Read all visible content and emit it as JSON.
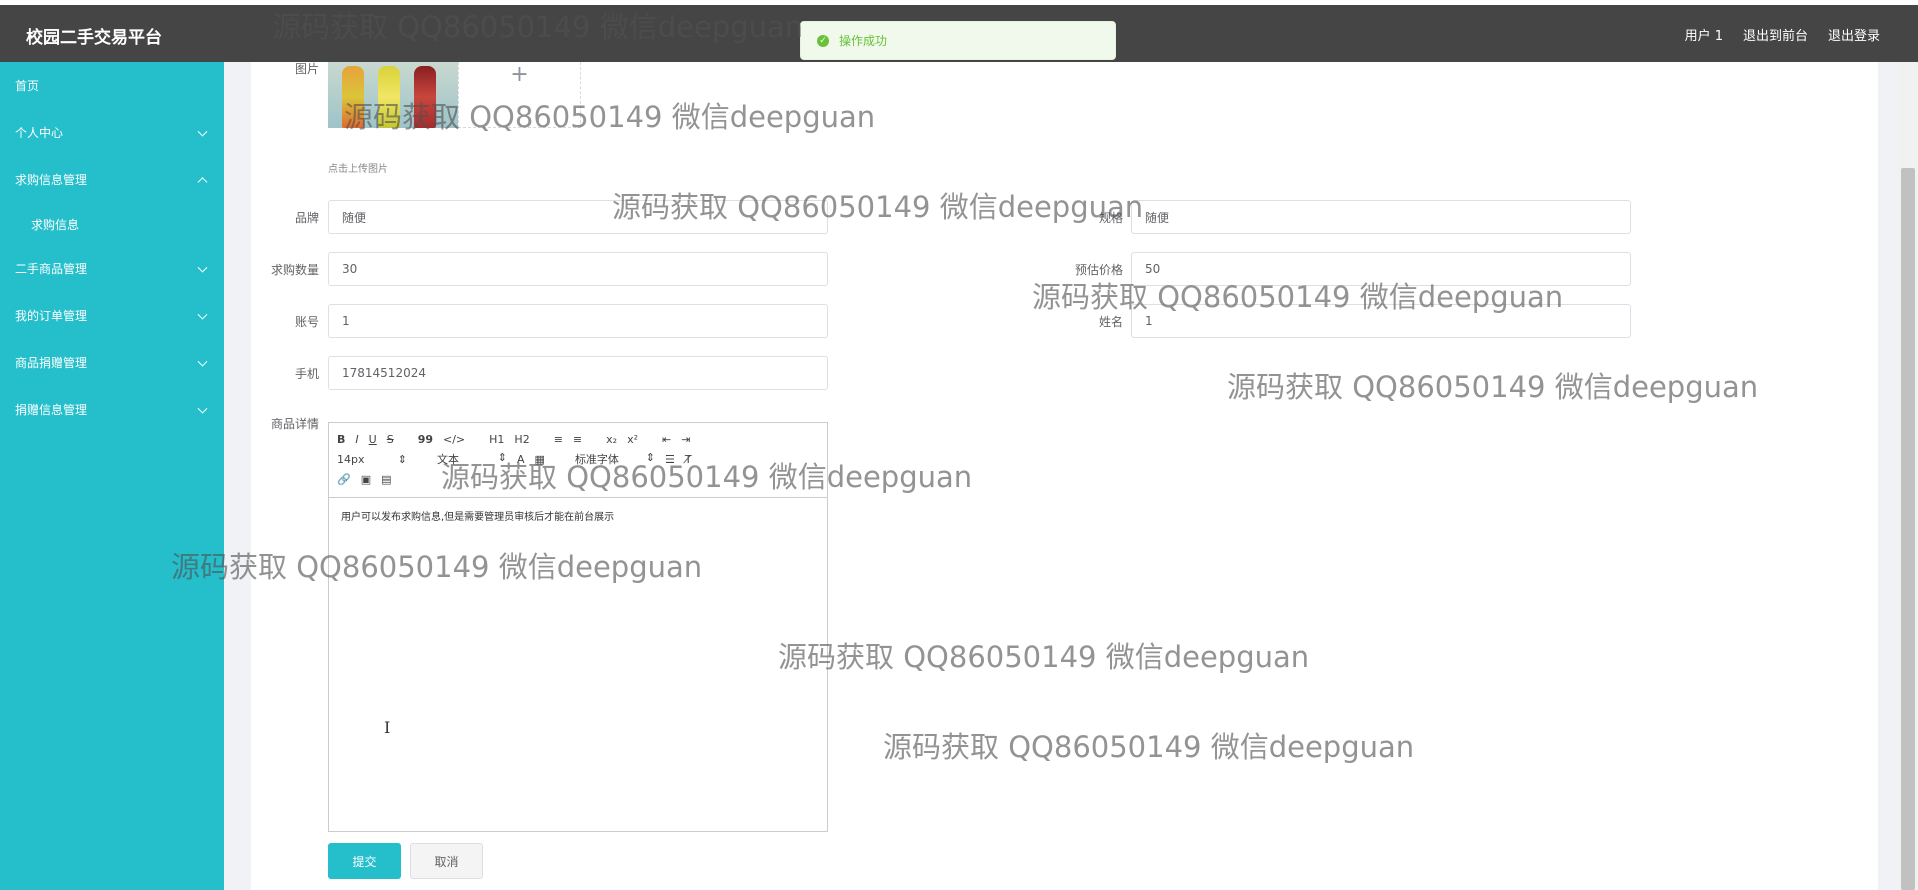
{
  "header": {
    "brand": "校园二手交易平台",
    "user": "用户 1",
    "to_front": "退出到前台",
    "logout": "退出登录"
  },
  "toast": {
    "message": "操作成功"
  },
  "sidebar": {
    "items": [
      {
        "label": "首页"
      },
      {
        "label": "个人中心"
      },
      {
        "label": "求购信息管理"
      },
      {
        "label": "求购信息"
      },
      {
        "label": "二手商品管理"
      },
      {
        "label": "我的订单管理"
      },
      {
        "label": "商品捐赠管理"
      },
      {
        "label": "捐赠信息管理"
      }
    ]
  },
  "form": {
    "image_label": "图片",
    "upload_tip": "点击上传图片",
    "brand_label": "品牌",
    "brand_value": "随便",
    "spec_label": "规格",
    "spec_value": "随便",
    "qty_label": "求购数量",
    "qty_value": "30",
    "price_label": "预估价格",
    "price_value": "50",
    "account_label": "账号",
    "account_value": "1",
    "name_label": "姓名",
    "name_value": "1",
    "phone_label": "手机",
    "phone_value": "17814512024",
    "detail_label": "商品详情",
    "submit": "提交",
    "cancel": "取消"
  },
  "editor": {
    "bold": "B",
    "italic": "I",
    "underline": "U",
    "strike": "S",
    "quote": "99",
    "code": "</>",
    "h1": "H1",
    "h2": "H2",
    "ol": "≡",
    "ul": "≡",
    "sub": "x₂",
    "sup": "x²",
    "outdent": "⇤",
    "indent": "⇥",
    "font_size": "14px",
    "text_style": "文本",
    "font_family": "标准字体",
    "content": "用户可以发布求购信息,但是需要管理员审核后才能在前台展示"
  },
  "watermark": "源码获取 QQ86050149 微信deepguan"
}
